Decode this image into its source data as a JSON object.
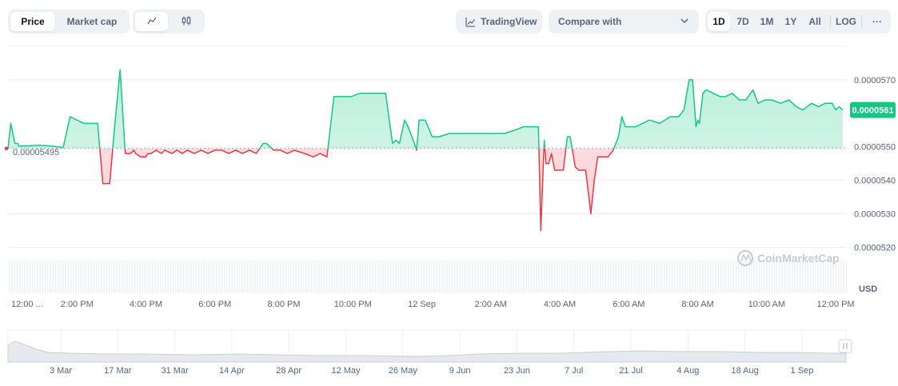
{
  "toolbar": {
    "price_label": "Price",
    "market_cap_label": "Market cap",
    "tradingview_label": "TradingView",
    "compare_label": "Compare with",
    "ranges": [
      "1D",
      "7D",
      "1M",
      "1Y",
      "All"
    ],
    "active_range": "1D",
    "log_label": "LOG",
    "more_label": "···",
    "icons": [
      "line-chart-icon",
      "candlestick-icon",
      "tradingview-icon",
      "chevron-down-icon",
      "more-icon"
    ]
  },
  "chart_data": {
    "type": "area",
    "currency_label": "USD",
    "baseline_value": 5.495e-05,
    "baseline_label": "0.00005495",
    "current_value": 5.61e-05,
    "current_label": "0.0000561",
    "ylim": [
      5.17e-05,
      5.8e-05
    ],
    "y_ticks": [
      5.2e-05,
      5.3e-05,
      5.4e-05,
      5.5e-05,
      5.7e-05
    ],
    "y_tick_labels": [
      "0.0000520",
      "0.0000530",
      "0.0000540",
      "0.0000550",
      "0.0000570"
    ],
    "x_tick_labels": [
      "12:00 ...",
      "2:00 PM",
      "4:00 PM",
      "6:00 PM",
      "8:00 PM",
      "10:00 PM",
      "12 Sep",
      "2:00 AM",
      "4:00 AM",
      "6:00 AM",
      "8:00 AM",
      "10:00 AM",
      "12:00 PM"
    ],
    "x_tick_hours": [
      0,
      2,
      4,
      6,
      8,
      10,
      12,
      14,
      16,
      18,
      20,
      22,
      24
    ],
    "x_range_hours": [
      0,
      24.3
    ],
    "up_color": "#16c784",
    "down_color": "#ea3943",
    "watermark": "CoinMarketCap",
    "series": [
      {
        "x": [
          0,
          0.08,
          0.2,
          0.28,
          0.32,
          0.4,
          0.6,
          0.9,
          1.3,
          1.6,
          1.8,
          2.2,
          2.6,
          2.75,
          2.95,
          3.1,
          3.25,
          3.4,
          3.55,
          3.65,
          3.7,
          3.85,
          4.0,
          4.05,
          4.15,
          4.3,
          4.45,
          4.55,
          4.75,
          4.9,
          5.05,
          5.2,
          5.4,
          5.6,
          5.8,
          6.0,
          6.2,
          6.4,
          6.6,
          6.8,
          7.0,
          7.2,
          7.4,
          7.5,
          7.7,
          7.9,
          8.1,
          8.3,
          8.6,
          8.85,
          9.05,
          9.25,
          9.45,
          9.7,
          9.95,
          10.2,
          10.45,
          10.7,
          10.95,
          11.15,
          11.25,
          11.35,
          11.5,
          11.6,
          11.75,
          11.85,
          11.92,
          12.1,
          12.3,
          12.5,
          12.8,
          13.2,
          13.6,
          14.0,
          14.4,
          14.7,
          14.95,
          15.15,
          15.38,
          15.45,
          15.55,
          15.6,
          15.68,
          15.76,
          15.85,
          16.0,
          16.1,
          16.22,
          16.3,
          16.45,
          16.55,
          16.6,
          16.75,
          16.9,
          17.0,
          17.1,
          17.15,
          17.25,
          17.4,
          17.55,
          17.7,
          17.8,
          17.9,
          18.0,
          18.2,
          18.4,
          18.6,
          18.9,
          19.2,
          19.45,
          19.6,
          19.75,
          19.85,
          19.95,
          20.0,
          20.05,
          20.15,
          20.25,
          20.45,
          20.65,
          20.8,
          21.0,
          21.2,
          21.4,
          21.6,
          21.75,
          21.95,
          22.15,
          22.4,
          22.65,
          22.85,
          23.05,
          23.3,
          23.5,
          23.7,
          23.9,
          24.0,
          24.1,
          24.2
        ],
        "y": [
          5.495e-05,
          5.57e-05,
          5.51e-05,
          5.51e-05,
          5.502e-05,
          5.502e-05,
          5.503e-05,
          5.505e-05,
          5.502e-05,
          5.498e-05,
          5.59e-05,
          5.57e-05,
          5.57e-05,
          5.39e-05,
          5.39e-05,
          5.57e-05,
          5.73e-05,
          5.48e-05,
          5.48e-05,
          5.49e-05,
          5.48e-05,
          5.47e-05,
          5.47e-05,
          5.48e-05,
          5.48e-05,
          5.49e-05,
          5.48e-05,
          5.49e-05,
          5.48e-05,
          5.49e-05,
          5.48e-05,
          5.49e-05,
          5.48e-05,
          5.49e-05,
          5.48e-05,
          5.49e-05,
          5.49e-05,
          5.48e-05,
          5.49e-05,
          5.48e-05,
          5.49e-05,
          5.48e-05,
          5.51e-05,
          5.51e-05,
          5.49e-05,
          5.49e-05,
          5.48e-05,
          5.49e-05,
          5.48e-05,
          5.47e-05,
          5.48e-05,
          5.47e-05,
          5.65e-05,
          5.65e-05,
          5.65e-05,
          5.66e-05,
          5.66e-05,
          5.66e-05,
          5.66e-05,
          5.51e-05,
          5.52e-05,
          5.51e-05,
          5.58e-05,
          5.56e-05,
          5.52e-05,
          5.49e-05,
          5.58e-05,
          5.58e-05,
          5.53e-05,
          5.53e-05,
          5.54e-05,
          5.54e-05,
          5.54e-05,
          5.54e-05,
          5.54e-05,
          5.55e-05,
          5.56e-05,
          5.56e-05,
          5.56e-05,
          5.25e-05,
          5.52e-05,
          5.45e-05,
          5.45e-05,
          5.48e-05,
          5.43e-05,
          5.43e-05,
          5.43e-05,
          5.53e-05,
          5.53e-05,
          5.44e-05,
          5.43e-05,
          5.43e-05,
          5.43e-05,
          5.3e-05,
          5.4e-05,
          5.47e-05,
          5.47e-05,
          5.47e-05,
          5.47e-05,
          5.49e-05,
          5.53e-05,
          5.59e-05,
          5.56e-05,
          5.56e-05,
          5.56e-05,
          5.57e-05,
          5.58e-05,
          5.57e-05,
          5.59e-05,
          5.59e-05,
          5.61e-05,
          5.7e-05,
          5.7e-05,
          5.56e-05,
          5.58e-05,
          5.57e-05,
          5.66e-05,
          5.67e-05,
          5.66e-05,
          5.65e-05,
          5.65e-05,
          5.66e-05,
          5.64e-05,
          5.64e-05,
          5.67e-05,
          5.63e-05,
          5.64e-05,
          5.64e-05,
          5.63e-05,
          5.64e-05,
          5.62e-05,
          5.61e-05,
          5.63e-05,
          5.62e-05,
          5.63e-05,
          5.63e-05,
          5.61e-05,
          5.62e-05,
          5.61e-05
        ]
      }
    ],
    "navigator": {
      "x_tick_labels": [
        "3 Mar",
        "17 Mar",
        "31 Mar",
        "14 Apr",
        "28 Apr",
        "12 May",
        "26 May",
        "9 Jun",
        "23 Jun",
        "7 Jul",
        "21 Jul",
        "4 Aug",
        "18 Aug",
        "1 Sep"
      ]
    }
  }
}
